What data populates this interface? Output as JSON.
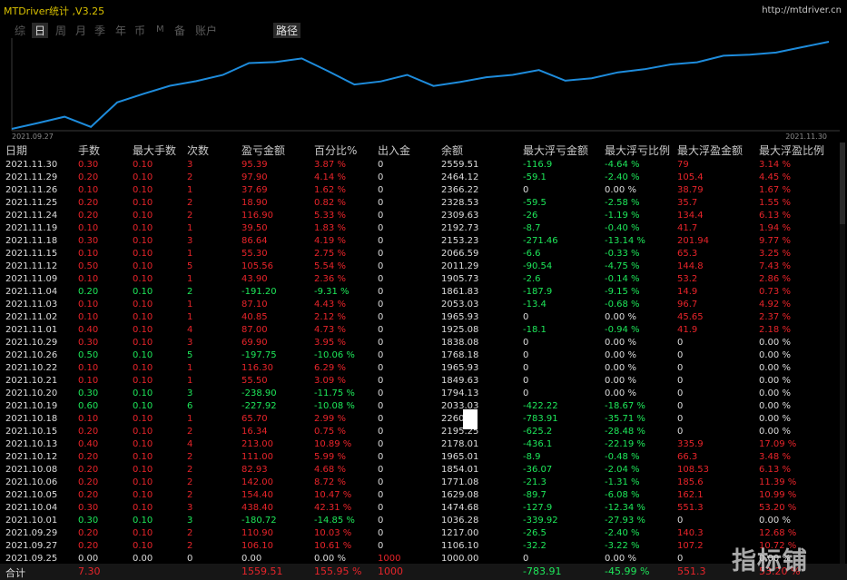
{
  "window": {
    "title": "MTDriver统计 ,V3.25",
    "url": "http://mtdriver.cn"
  },
  "tabs": [
    "综",
    "日",
    "周",
    "月",
    "季",
    "年",
    "币",
    "M",
    "备",
    "账户"
  ],
  "active_tab": "日",
  "extra_tab": "路径",
  "chart": {
    "start_label": "2021.09.27",
    "end_label": "2021.11.30",
    "line_color": "#1e8cdc",
    "balances": [
      1000.0,
      1106.1,
      1217.0,
      1036.28,
      1474.68,
      1629.08,
      1771.08,
      1854.01,
      1965.01,
      2178.01,
      2195.25,
      2260,
      2033.03,
      1794.13,
      1849.63,
      1965.93,
      1768.18,
      1838.08,
      1925.08,
      1965.93,
      2053.03,
      1861.83,
      1905.73,
      2011.29,
      2066.59,
      2153.23,
      2192.73,
      2309.63,
      2328.53,
      2366.22,
      2464.12,
      2559.51
    ]
  },
  "table": {
    "headers": [
      "日期",
      "手数",
      "最大手数",
      "次数",
      "盈亏金额",
      "百分比%",
      "出入金",
      "余额",
      "最大浮亏金额",
      "最大浮亏比例",
      "最大浮盈金额",
      "最大浮盈比例"
    ],
    "rows": [
      [
        "2021.11.30",
        "0.30",
        "0.10",
        "3",
        "95.39",
        "3.87 %",
        "0",
        "2559.51",
        "-116.9",
        "-4.64 %",
        "79",
        "3.14 %"
      ],
      [
        "2021.11.29",
        "0.20",
        "0.10",
        "2",
        "97.90",
        "4.14 %",
        "0",
        "2464.12",
        "-59.1",
        "-2.40 %",
        "105.4",
        "4.45 %"
      ],
      [
        "2021.11.26",
        "0.10",
        "0.10",
        "1",
        "37.69",
        "1.62 %",
        "0",
        "2366.22",
        "0",
        "0.00 %",
        "38.79",
        "1.67 %"
      ],
      [
        "2021.11.25",
        "0.20",
        "0.10",
        "2",
        "18.90",
        "0.82 %",
        "0",
        "2328.53",
        "-59.5",
        "-2.58 %",
        "35.7",
        "1.55 %"
      ],
      [
        "2021.11.24",
        "0.20",
        "0.10",
        "2",
        "116.90",
        "5.33 %",
        "0",
        "2309.63",
        "-26",
        "-1.19 %",
        "134.4",
        "6.13 %"
      ],
      [
        "2021.11.19",
        "0.10",
        "0.10",
        "1",
        "39.50",
        "1.83 %",
        "0",
        "2192.73",
        "-8.7",
        "-0.40 %",
        "41.7",
        "1.94 %"
      ],
      [
        "2021.11.18",
        "0.30",
        "0.10",
        "3",
        "86.64",
        "4.19 %",
        "0",
        "2153.23",
        "-271.46",
        "-13.14 %",
        "201.94",
        "9.77 %"
      ],
      [
        "2021.11.15",
        "0.10",
        "0.10",
        "1",
        "55.30",
        "2.75 %",
        "0",
        "2066.59",
        "-6.6",
        "-0.33 %",
        "65.3",
        "3.25 %"
      ],
      [
        "2021.11.12",
        "0.50",
        "0.10",
        "5",
        "105.56",
        "5.54 %",
        "0",
        "2011.29",
        "-90.54",
        "-4.75 %",
        "144.8",
        "7.43 %"
      ],
      [
        "2021.11.09",
        "0.10",
        "0.10",
        "1",
        "43.90",
        "2.36 %",
        "0",
        "1905.73",
        "-2.6",
        "-0.14 %",
        "53.2",
        "2.86 %"
      ],
      [
        "2021.11.04",
        "0.20",
        "0.10",
        "2",
        "-191.20",
        "-9.31 %",
        "0",
        "1861.83",
        "-187.9",
        "-9.15 %",
        "14.9",
        "0.73 %"
      ],
      [
        "2021.11.03",
        "0.10",
        "0.10",
        "1",
        "87.10",
        "4.43 %",
        "0",
        "2053.03",
        "-13.4",
        "-0.68 %",
        "96.7",
        "4.92 %"
      ],
      [
        "2021.11.02",
        "0.10",
        "0.10",
        "1",
        "40.85",
        "2.12 %",
        "0",
        "1965.93",
        "0",
        "0.00 %",
        "45.65",
        "2.37 %"
      ],
      [
        "2021.11.01",
        "0.40",
        "0.10",
        "4",
        "87.00",
        "4.73 %",
        "0",
        "1925.08",
        "-18.1",
        "-0.94 %",
        "41.9",
        "2.18 %"
      ],
      [
        "2021.10.29",
        "0.30",
        "0.10",
        "3",
        "69.90",
        "3.95 %",
        "0",
        "1838.08",
        "0",
        "0.00 %",
        "0",
        "0.00 %"
      ],
      [
        "2021.10.26",
        "0.50",
        "0.10",
        "5",
        "-197.75",
        "-10.06 %",
        "0",
        "1768.18",
        "0",
        "0.00 %",
        "0",
        "0.00 %"
      ],
      [
        "2021.10.22",
        "0.10",
        "0.10",
        "1",
        "116.30",
        "6.29 %",
        "0",
        "1965.93",
        "0",
        "0.00 %",
        "0",
        "0.00 %"
      ],
      [
        "2021.10.21",
        "0.10",
        "0.10",
        "1",
        "55.50",
        "3.09 %",
        "0",
        "1849.63",
        "0",
        "0.00 %",
        "0",
        "0.00 %"
      ],
      [
        "2021.10.20",
        "0.30",
        "0.10",
        "3",
        "-238.90",
        "-11.75 %",
        "0",
        "1794.13",
        "0",
        "0.00 %",
        "0",
        "0.00 %"
      ],
      [
        "2021.10.19",
        "0.60",
        "0.10",
        "6",
        "-227.92",
        "-10.08 %",
        "0",
        "2033.03",
        "-422.22",
        "-18.67 %",
        "0",
        "0.00 %"
      ],
      [
        "2021.10.18",
        "0.10",
        "0.10",
        "1",
        "65.70",
        "2.99 %",
        "0",
        "2260",
        "-783.91",
        "-35.71 %",
        "0",
        "0.00 %"
      ],
      [
        "2021.10.15",
        "0.20",
        "0.10",
        "2",
        "16.34",
        "0.75 %",
        "0",
        "2195.25",
        "-625.2",
        "-28.48 %",
        "0",
        "0.00 %"
      ],
      [
        "2021.10.13",
        "0.40",
        "0.10",
        "4",
        "213.00",
        "10.89 %",
        "0",
        "2178.01",
        "-436.1",
        "-22.19 %",
        "335.9",
        "17.09 %"
      ],
      [
        "2021.10.12",
        "0.20",
        "0.10",
        "2",
        "111.00",
        "5.99 %",
        "0",
        "1965.01",
        "-8.9",
        "-0.48 %",
        "66.3",
        "3.48 %"
      ],
      [
        "2021.10.08",
        "0.20",
        "0.10",
        "2",
        "82.93",
        "4.68 %",
        "0",
        "1854.01",
        "-36.07",
        "-2.04 %",
        "108.53",
        "6.13 %"
      ],
      [
        "2021.10.06",
        "0.20",
        "0.10",
        "2",
        "142.00",
        "8.72 %",
        "0",
        "1771.08",
        "-21.3",
        "-1.31 %",
        "185.6",
        "11.39 %"
      ],
      [
        "2021.10.05",
        "0.20",
        "0.10",
        "2",
        "154.40",
        "10.47 %",
        "0",
        "1629.08",
        "-89.7",
        "-6.08 %",
        "162.1",
        "10.99 %"
      ],
      [
        "2021.10.04",
        "0.30",
        "0.10",
        "3",
        "438.40",
        "42.31 %",
        "0",
        "1474.68",
        "-127.9",
        "-12.34 %",
        "551.3",
        "53.20 %"
      ],
      [
        "2021.10.01",
        "0.30",
        "0.10",
        "3",
        "-180.72",
        "-14.85 %",
        "0",
        "1036.28",
        "-339.92",
        "-27.93 %",
        "0",
        "0.00 %"
      ],
      [
        "2021.09.29",
        "0.20",
        "0.10",
        "2",
        "110.90",
        "10.03 %",
        "0",
        "1217.00",
        "-26.5",
        "-2.40 %",
        "140.3",
        "12.68 %"
      ],
      [
        "2021.09.27",
        "0.20",
        "0.10",
        "2",
        "106.10",
        "10.61 %",
        "0",
        "1106.10",
        "-32.2",
        "-3.22 %",
        "107.2",
        "10.72 %"
      ],
      [
        "2021.09.25",
        "0.00",
        "0.00",
        "0",
        "0.00",
        "0.00 %",
        "1000",
        "1000.00",
        "0",
        "0.00 %",
        "0",
        "0.00 %"
      ]
    ],
    "total": [
      "合计",
      "7.30",
      "",
      "",
      "1559.51",
      "155.95 %",
      "1000",
      "",
      "-783.91",
      "-45.99 %",
      "551.3",
      "53.20 %"
    ]
  },
  "colors": {
    "profit": "#e8242a",
    "loss": "#1ee85a",
    "neutral": "#dcdcdc"
  },
  "watermark": "指标铺"
}
